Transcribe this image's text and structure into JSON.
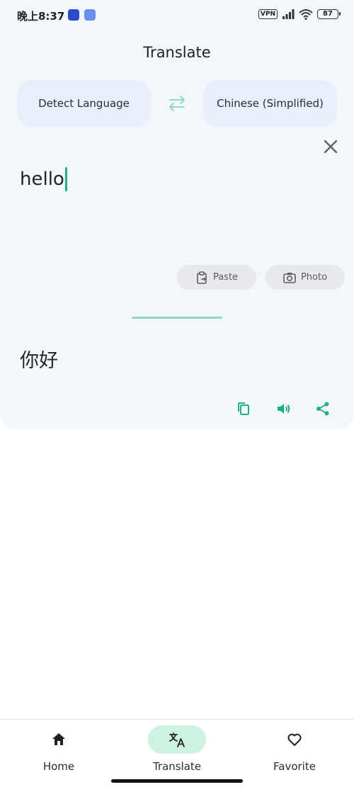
{
  "status_bar": {
    "time": "晚上8:37",
    "vpn": "VPN",
    "battery": "87",
    "icons": [
      "app-notification-icon",
      "app-notification-icon",
      "signal-icon",
      "wifi-icon",
      "battery-icon"
    ]
  },
  "header": {
    "title": "Translate"
  },
  "languages": {
    "source": "Detect Language",
    "target": "Chinese (Simplified)",
    "swap_icon": "swap-arrows-icon"
  },
  "input": {
    "text": "hello"
  },
  "chips": {
    "paste": "Paste",
    "photo": "Photo"
  },
  "output": {
    "text": "你好"
  },
  "actions": [
    "copy-icon",
    "speaker-icon",
    "share-icon"
  ],
  "nav": {
    "items": [
      {
        "label": "Home",
        "icon": "home-icon",
        "active": false
      },
      {
        "label": "Translate",
        "icon": "translate-icon",
        "active": true
      },
      {
        "label": "Favorite",
        "icon": "heart-icon",
        "active": false
      }
    ]
  },
  "colors": {
    "accent": "#1db37f",
    "card_bg": "#f3f6fb",
    "lang_button_bg": "#e9eefb",
    "nav_active_pill": "#cdf2e2"
  }
}
